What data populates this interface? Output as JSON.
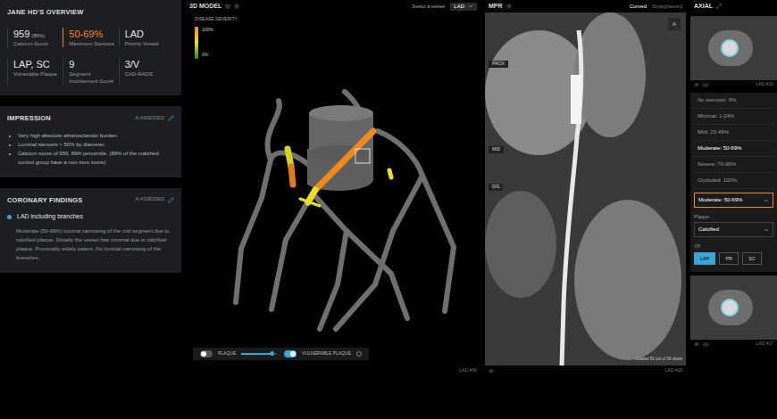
{
  "overview": {
    "title": "JANE HD'S OVERVIEW",
    "stats": [
      {
        "value": "959",
        "sub": "(89%)",
        "label": "Calcium Score",
        "highlight": false
      },
      {
        "value": "50-69%",
        "sub": "",
        "label": "Maximum Stenosis",
        "highlight": true
      },
      {
        "value": "LAD",
        "sub": "",
        "label": "Priority Vessel",
        "highlight": false
      },
      {
        "value": "LAP, SC",
        "sub": "",
        "label": "Vulnerable Plaque",
        "highlight": false
      },
      {
        "value": "9",
        "sub": "",
        "label": "Segment Involvement Score",
        "highlight": false
      },
      {
        "value": "3/V",
        "sub": "",
        "label": "CAD-RADS",
        "highlight": false
      }
    ]
  },
  "impression": {
    "title": "IMPRESSION",
    "badge": "AI ASSESSED",
    "bullets": [
      "Very high absolute atherosclerotic burden.",
      "Luminal stenosis > 50% by diameter.",
      "Calcium score of 959, 89th percentile. (89% of the matched control group have a non-zero score)"
    ]
  },
  "findings": {
    "title": "CORONARY FINDINGS",
    "badge": "AI ASSESSED",
    "items": [
      {
        "name": "LAD including branches",
        "text": "Moderate (50-69%) luminal narrowing of the mid segment due to calcified plaque. Distally the vessel has minimal due to calcified plaque. Proximally widely patent. No luminal narrowing of the branches."
      }
    ]
  },
  "model": {
    "title": "3D MODEL",
    "vesselLabel": "Select a vessel",
    "vessel": "LAD",
    "legend": {
      "title": "DISEASE SEVERITY",
      "max": "100%",
      "min": "0%"
    },
    "toolbar": [
      {
        "label": "PLAQUE",
        "on": false,
        "level": 0.85
      },
      {
        "label": "VULNERABLE PLAQUE",
        "on": true,
        "level": 0
      }
    ],
    "caption": "LAD #36"
  },
  "mpr": {
    "title": "MPR",
    "modes": [
      {
        "label": "Curved",
        "selected": true
      },
      {
        "label": "Straightened",
        "selected": false
      }
    ],
    "orientation": "A",
    "markers": [
      "PROX",
      "MID",
      "DIS"
    ],
    "status": "Loaded 50 out of 50 slices",
    "caption": "LAD #18"
  },
  "axial": {
    "title": "AXIAL",
    "captions": [
      "LAD #16",
      "LAD #17"
    ],
    "options": [
      {
        "label": "No stenosis: 0%",
        "selected": false
      },
      {
        "label": "Minimal: 1-24%",
        "selected": false
      },
      {
        "label": "Mild: 25-49%",
        "selected": false
      },
      {
        "label": "Moderate: 50-69%",
        "selected": true
      },
      {
        "label": "Severe: 70-99%",
        "selected": false
      },
      {
        "label": "Occluded: 100%",
        "selected": false
      }
    ],
    "stenosis": "Moderate: 50-69%",
    "expanded": true,
    "plaqueLabel": "Plaque",
    "plaque": "Calcified",
    "vpLabel": "VP",
    "chips": [
      {
        "label": "LAP",
        "selected": true
      },
      {
        "label": "PR",
        "selected": false
      },
      {
        "label": "SC",
        "selected": false
      }
    ]
  }
}
